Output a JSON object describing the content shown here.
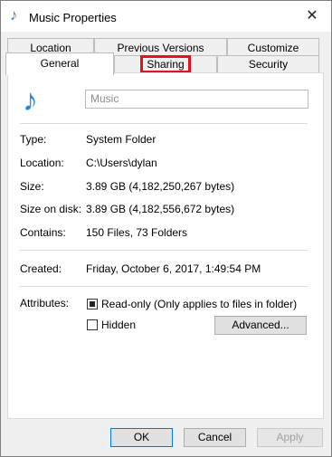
{
  "window": {
    "title": "Music Properties",
    "close_glyph": "✕"
  },
  "tabs": {
    "row1": [
      "Location",
      "Previous Versions",
      "Customize"
    ],
    "row2": [
      "General",
      "Sharing",
      "Security"
    ],
    "active": "General",
    "highlighted": "Sharing"
  },
  "folder": {
    "name_placeholder": "Music"
  },
  "properties": [
    {
      "label": "Type:",
      "value": "System Folder"
    },
    {
      "label": "Location:",
      "value": "C:\\Users\\dylan"
    },
    {
      "label": "Size:",
      "value": "3.89 GB (4,182,250,267 bytes)"
    },
    {
      "label": "Size on disk:",
      "value": "3.89 GB (4,182,556,672 bytes)"
    },
    {
      "label": "Contains:",
      "value": "150 Files, 73 Folders"
    }
  ],
  "created": {
    "label": "Created:",
    "value": "Friday, October 6, 2017, 1:49:54 PM"
  },
  "attributes": {
    "label": "Attributes:",
    "readonly": {
      "label": "Read-only (Only applies to files in folder)",
      "state": "indeterminate"
    },
    "hidden": {
      "label": "Hidden",
      "checked": false
    },
    "advanced_button": "Advanced..."
  },
  "buttons": {
    "ok": "OK",
    "cancel": "Cancel",
    "apply": "Apply"
  },
  "colors": {
    "accent": "#0078d7",
    "icon": "#1e88e5",
    "highlight_box": "#e0141c"
  },
  "icons": {
    "title_icon": "music-note-icon",
    "folder_icon": "music-note-icon"
  }
}
